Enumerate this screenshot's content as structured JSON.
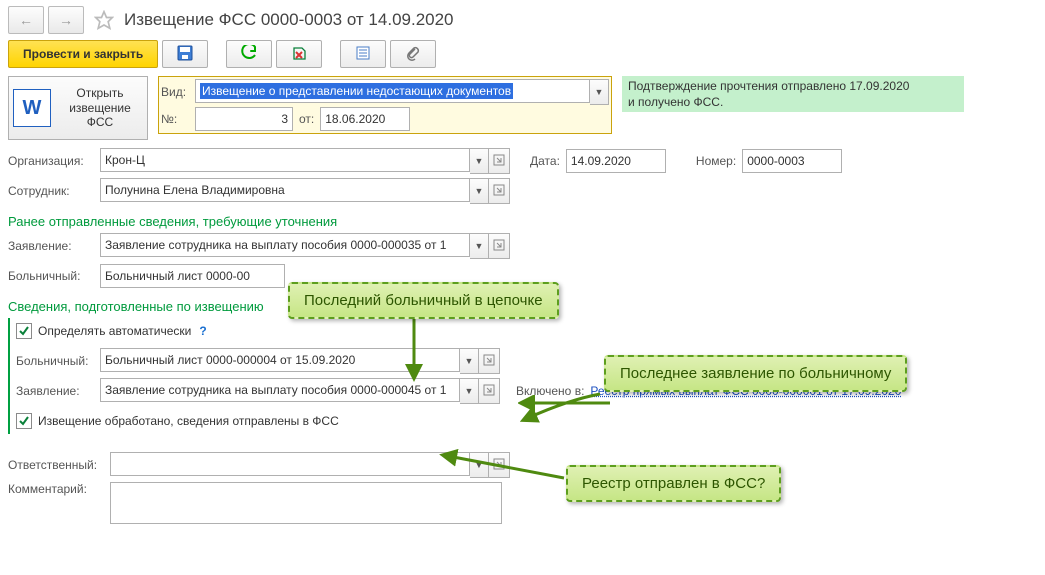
{
  "header": {
    "title": "Извещение ФСС 0000-0003 от 14.09.2020"
  },
  "toolbar": {
    "post_close": "Провести и закрыть"
  },
  "word_button": {
    "line1": "Открыть",
    "line2": "извещение",
    "line3": "ФСС"
  },
  "vid": {
    "label": "Вид:",
    "value": "Извещение о представлении недостающих документов",
    "num_label": "№:",
    "num_value": "3",
    "date_label": "от:",
    "date_value": "18.06.2020"
  },
  "confirm": {
    "line1": "Подтверждение прочтения отправлено 17.09.2020",
    "line2": "и получено ФСС."
  },
  "org": {
    "label": "Организация:",
    "value": "Крон-Ц"
  },
  "date": {
    "label": "Дата:",
    "value": "14.09.2020"
  },
  "number": {
    "label": "Номер:",
    "value": "0000-0003"
  },
  "employee": {
    "label": "Сотрудник:",
    "value": "Полунина Елена Владимировна"
  },
  "section1": {
    "title": "Ранее отправленные сведения, требующие уточнения",
    "zayav_label": "Заявление:",
    "zayav_value": "Заявление сотрудника на выплату пособия 0000-000035 от 1",
    "boln_label": "Больничный:",
    "boln_value": "Больничный лист 0000-00"
  },
  "section2": {
    "title": "Сведения, подготовленные по извещению",
    "auto_label": "Определять автоматически",
    "boln_label": "Больничный:",
    "boln_value": "Больничный лист 0000-000004 от 15.09.2020",
    "zayav_label": "Заявление:",
    "zayav_value": "Заявление сотрудника на выплату пособия 0000-000045 от 1",
    "incl_label": "Включено в:",
    "incl_link": "Реестр прямых выплат ФСС 0000-000001 от 17.09.2020",
    "done_label": "Извещение обработано, сведения отправлены в ФСС"
  },
  "footer": {
    "resp_label": "Ответственный:",
    "comment_label": "Комментарий:"
  },
  "tips": {
    "t1": "Последний больничный в цепочке",
    "t2": "Последнее заявление по больничному",
    "t3": "Реестр отправлен в ФСС?"
  }
}
